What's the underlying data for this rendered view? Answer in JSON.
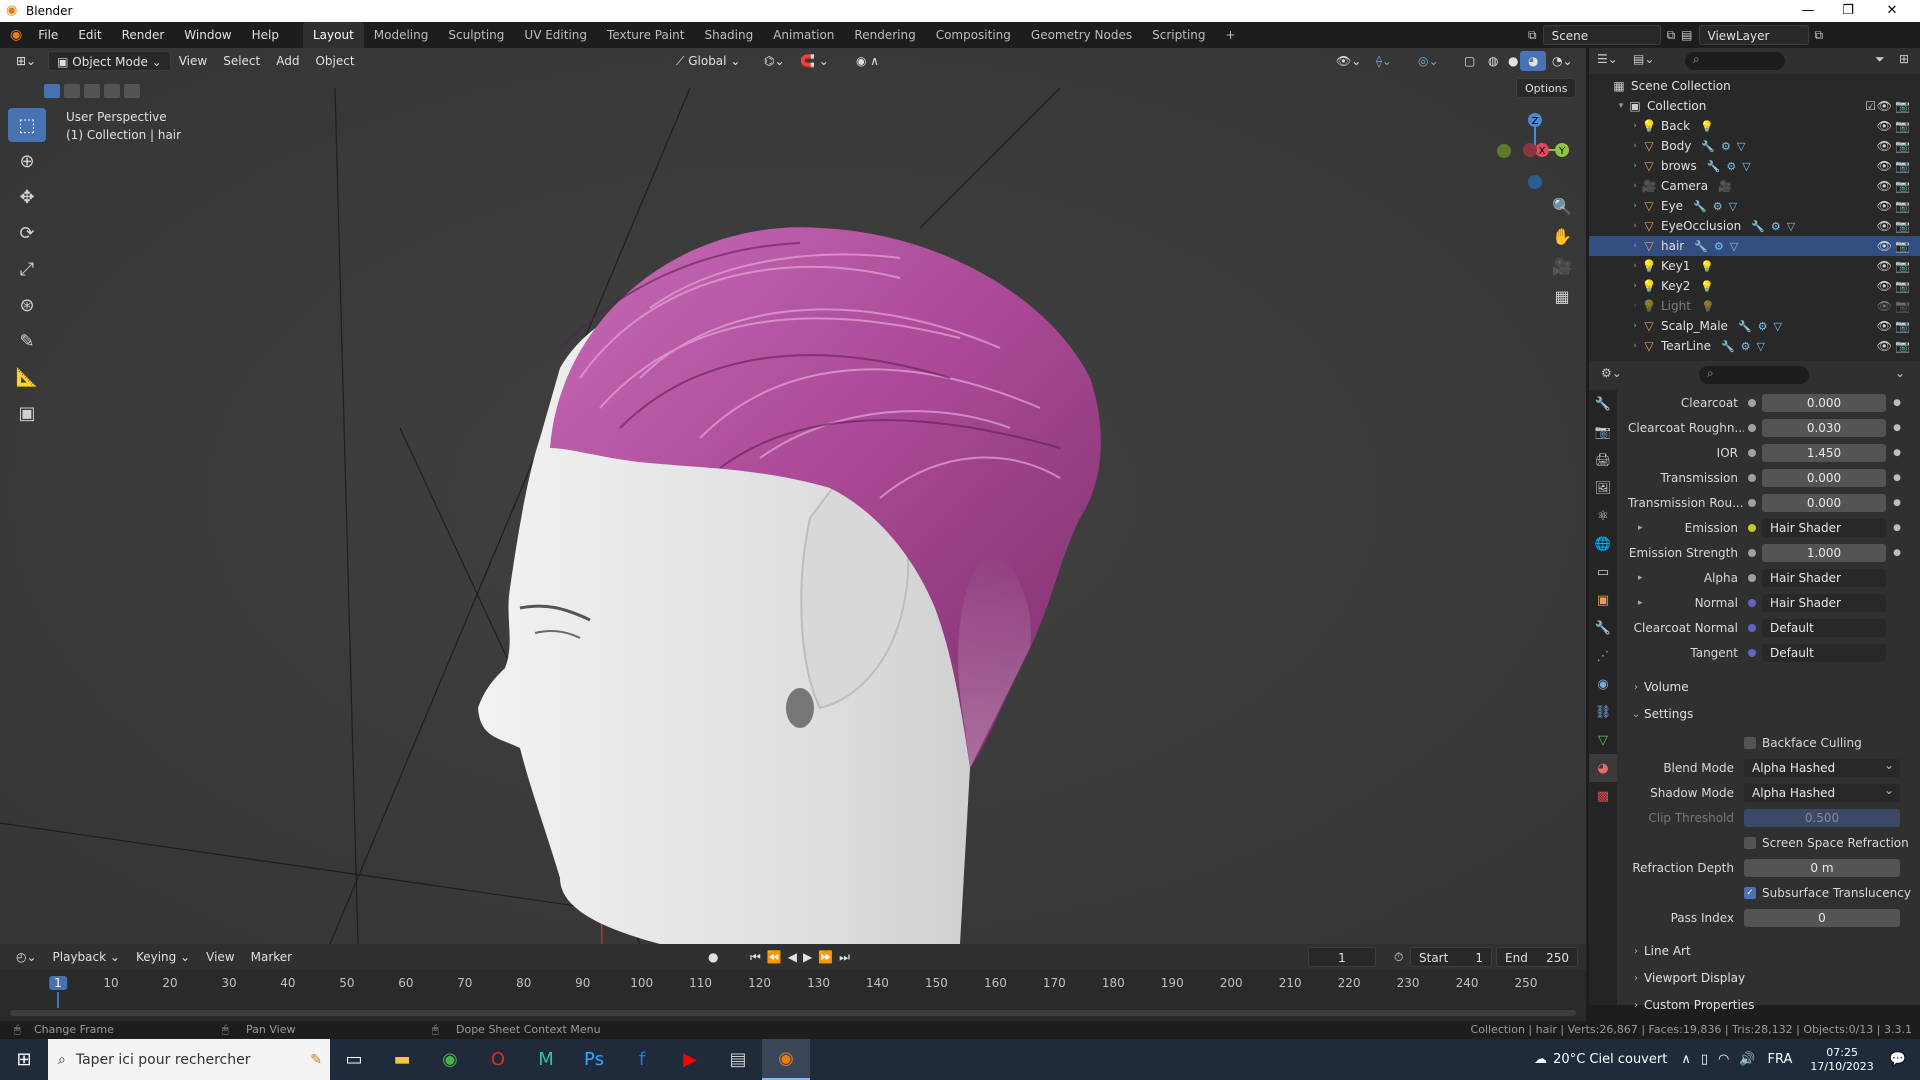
{
  "window": {
    "title": "Blender",
    "minimize": "—",
    "maximize": "❐",
    "close": "✕"
  },
  "menu": [
    "File",
    "Edit",
    "Render",
    "Window",
    "Help"
  ],
  "workspaces": [
    "Layout",
    "Modeling",
    "Sculpting",
    "UV Editing",
    "Texture Paint",
    "Shading",
    "Animation",
    "Rendering",
    "Compositing",
    "Geometry Nodes",
    "Scripting"
  ],
  "active_workspace": "Layout",
  "scene": {
    "label": "Scene",
    "view_layer": "ViewLayer"
  },
  "viewport": {
    "mode": "Object Mode",
    "menus": [
      "View",
      "Select",
      "Add",
      "Object"
    ],
    "transform_orientation": "Global",
    "options": "Options",
    "perspective": "User Perspective",
    "collection_info": "(1) Collection | hair",
    "gizmo": {
      "x": "X",
      "y": "Y",
      "z": "Z"
    }
  },
  "outliner": {
    "root": "Scene Collection",
    "collection": "Collection",
    "items": [
      {
        "name": "Back",
        "icon": "light-icon"
      },
      {
        "name": "Body",
        "icon": "mesh-icon"
      },
      {
        "name": "brows",
        "icon": "mesh-icon"
      },
      {
        "name": "Camera",
        "icon": "camera-icon"
      },
      {
        "name": "Eye",
        "icon": "mesh-icon"
      },
      {
        "name": "EyeOcclusion",
        "icon": "mesh-icon"
      },
      {
        "name": "hair",
        "icon": "mesh-icon"
      },
      {
        "name": "Key1",
        "icon": "light-icon"
      },
      {
        "name": "Key2",
        "icon": "light-icon"
      },
      {
        "name": "Light",
        "icon": "light-icon"
      },
      {
        "name": "Scalp_Male",
        "icon": "mesh-icon"
      },
      {
        "name": "TearLine",
        "icon": "mesh-icon"
      }
    ]
  },
  "properties": {
    "rows": [
      {
        "label": "Clearcoat",
        "value": "0.000",
        "kind": "num"
      },
      {
        "label": "Clearcoat Roughn...",
        "value": "0.030",
        "kind": "num"
      },
      {
        "label": "IOR",
        "value": "1.450",
        "kind": "num"
      },
      {
        "label": "Transmission",
        "value": "0.000",
        "kind": "num"
      },
      {
        "label": "Transmission Rou...",
        "value": "0.000",
        "kind": "num"
      },
      {
        "label": "Emission",
        "value": "Hair Shader",
        "kind": "socket",
        "dot": "#c7c729",
        "expand": true
      },
      {
        "label": "Emission Strength",
        "value": "1.000",
        "kind": "num"
      },
      {
        "label": "Alpha",
        "value": "Hair Shader",
        "kind": "socket",
        "dot": "#a1a1a1",
        "expand": true
      },
      {
        "label": "Normal",
        "value": "Hair Shader",
        "kind": "socket",
        "dot": "#6363c7",
        "expand": true
      },
      {
        "label": "Clearcoat Normal",
        "value": "Default",
        "kind": "socket",
        "dot": "#6363c7"
      },
      {
        "label": "Tangent",
        "value": "Default",
        "kind": "socket",
        "dot": "#6363c7"
      }
    ],
    "volume": "Volume",
    "settings": "Settings",
    "backface_culling": "Backface Culling",
    "blend_mode_label": "Blend Mode",
    "blend_mode": "Alpha Hashed",
    "shadow_mode_label": "Shadow Mode",
    "shadow_mode": "Alpha Hashed",
    "clip_threshold_label": "Clip Threshold",
    "clip_threshold": "0.500",
    "screen_space_refraction": "Screen Space Refraction",
    "refraction_depth_label": "Refraction Depth",
    "refraction_depth": "0 m",
    "subsurface_translucency": "Subsurface Translucency",
    "pass_index_label": "Pass Index",
    "pass_index": "0",
    "line_art": "Line Art",
    "viewport_display": "Viewport Display",
    "custom_properties": "Custom Properties"
  },
  "timeline": {
    "menus": [
      "Playback",
      "Keying",
      "View",
      "Marker"
    ],
    "current_frame": "1",
    "start_label": "Start",
    "start": "1",
    "end_label": "End",
    "end": "250",
    "ticks": [
      "1",
      "10",
      "20",
      "30",
      "40",
      "50",
      "60",
      "70",
      "80",
      "90",
      "100",
      "110",
      "120",
      "130",
      "140",
      "150",
      "160",
      "170",
      "180",
      "190",
      "200",
      "210",
      "220",
      "230",
      "240",
      "250"
    ]
  },
  "status": {
    "left": "Change Frame",
    "middle": "Pan View",
    "right_hint": "Dope Sheet Context Menu",
    "stats": "Collection | hair | Verts:26,867 | Faces:19,836 | Tris:28,132 | Objects:0/13 | 3.3.1"
  },
  "taskbar": {
    "search": "Taper ici pour rechercher",
    "weather": "20°C  Ciel couvert",
    "lang": "FRA",
    "time": "07:25",
    "date": "17/10/2023"
  },
  "colors": {
    "accent": "#4772b3",
    "hair": "#b0509a",
    "skin": "#e6e6e6"
  }
}
